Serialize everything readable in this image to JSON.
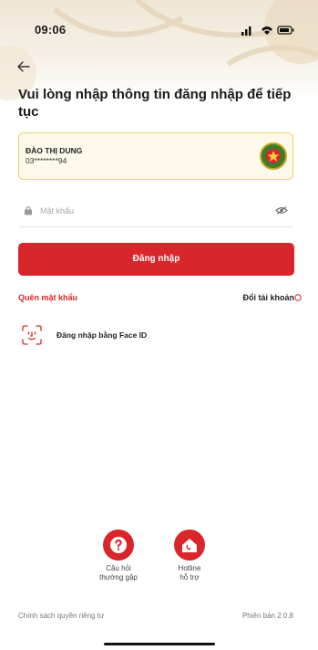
{
  "status_bar": {
    "time": "09:06"
  },
  "header": {
    "title": "Vui lòng nhập thông tin đăng nhập để tiếp tục"
  },
  "account": {
    "name": "ĐÀO THỊ DUNG",
    "phone": "03********94"
  },
  "password": {
    "placeholder": "Mật khẩu"
  },
  "actions": {
    "login_label": "Đăng nhập",
    "forgot_label": "Quên mật khẩu",
    "switch_label": "Đổi tài khoản",
    "faceid_label": "Đăng nhập bằng Face ID"
  },
  "help": [
    {
      "line1": "Câu hỏi",
      "line2": "thường gặp",
      "icon": "question-icon"
    },
    {
      "line1": "Hotline",
      "line2": "hỗ trợ",
      "icon": "hotline-icon"
    }
  ],
  "footer": {
    "privacy": "Chính sách quyền riêng tư",
    "version": "Phiên bản 2.0.8"
  },
  "colors": {
    "accent": "#d9262a",
    "card_border": "#e8d36e",
    "card_bg": "#fdf9ea"
  }
}
